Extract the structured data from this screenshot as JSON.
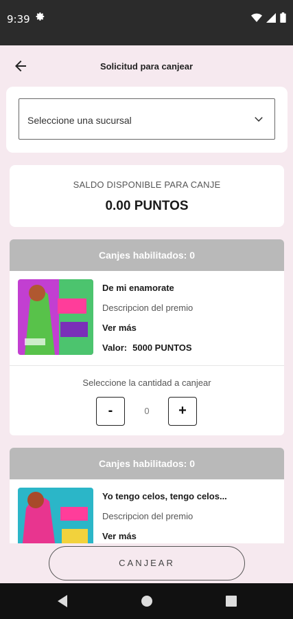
{
  "status_bar": {
    "time": "9:39"
  },
  "header": {
    "title": "Solicitud para canjear"
  },
  "branch_select": {
    "placeholder": "Seleccione una sucursal"
  },
  "balance": {
    "label": "SALDO DISPONIBLE PARA CANJE",
    "amount": "0.00 PUNTOS"
  },
  "prizes": [
    {
      "header": "Canjes habilitados: 0",
      "title": "De mi enamorate",
      "description": "Descripcion del premio",
      "more": "Ver más",
      "value_label": "Valor:",
      "value": "5000 PUNTOS",
      "quantity_label": "Seleccione la cantidad a canjear",
      "quantity": "0",
      "minus": "-",
      "plus": "+",
      "thumb_bg": "#c23fd1"
    },
    {
      "header": "Canjes habilitados: 0",
      "title": "Yo tengo celos, tengo celos...",
      "description": "Descripcion del premio",
      "more": "Ver más",
      "thumb_bg": "#2bb6c8"
    }
  ],
  "footer": {
    "redeem_label": "CANJEAR"
  },
  "colors": {
    "background": "#f6e9ef",
    "card_header": "#b9b9b9",
    "status_bar": "#2b2b2b"
  }
}
